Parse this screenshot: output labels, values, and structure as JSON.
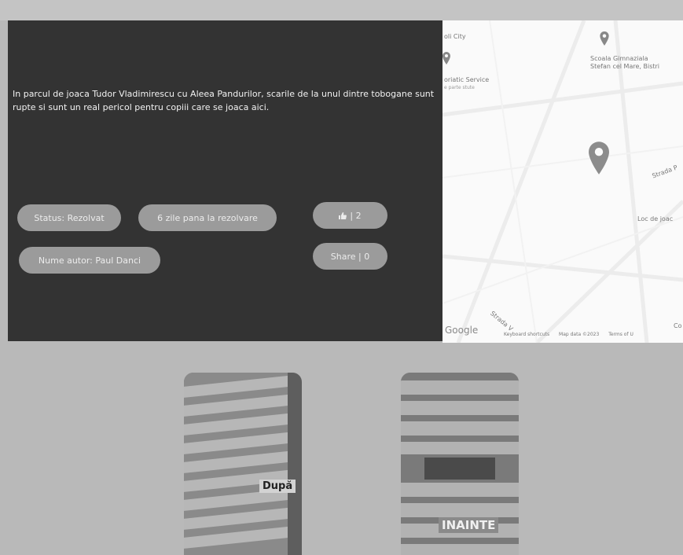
{
  "report": {
    "description": "In parcul de joaca Tudor Vladimirescu cu Aleea Pandurilor, scarile de la unul dintre tobogane sunt rupte si sunt un real pericol pentru copiii care se joaca aici.",
    "status": "Status: Rezolvat",
    "days_to_resolve": "6 zile pana la rezolvare",
    "author": "Nume autor: Paul Danci",
    "like_label": "| 2",
    "like_icon": "thumbs-up-icon",
    "share_label": "Share | 0"
  },
  "map": {
    "labels": {
      "city": "oli City",
      "service_1": "oriatic Service",
      "service_2": "e parte stute",
      "school_1": "Scoala Gimnaziala",
      "school_2": "Stefan cel Mare, Bistri",
      "street_1": "Strada P",
      "playground": "Loc de joac",
      "street_2": "Strada V",
      "corner": "Co"
    },
    "google": "Google",
    "attribution": {
      "shortcuts": "Keyboard shortcuts",
      "map_data": "Map data ©2023",
      "terms": "Terms of U"
    },
    "pin_icon": "map-pin-icon"
  },
  "photos": {
    "after_caption": "După",
    "before_caption": "INAINTE"
  },
  "colors": {
    "panel": "#333333",
    "page": "#b9b9b9",
    "pill": "#9b9b9b",
    "map_background": "#fafafa"
  }
}
